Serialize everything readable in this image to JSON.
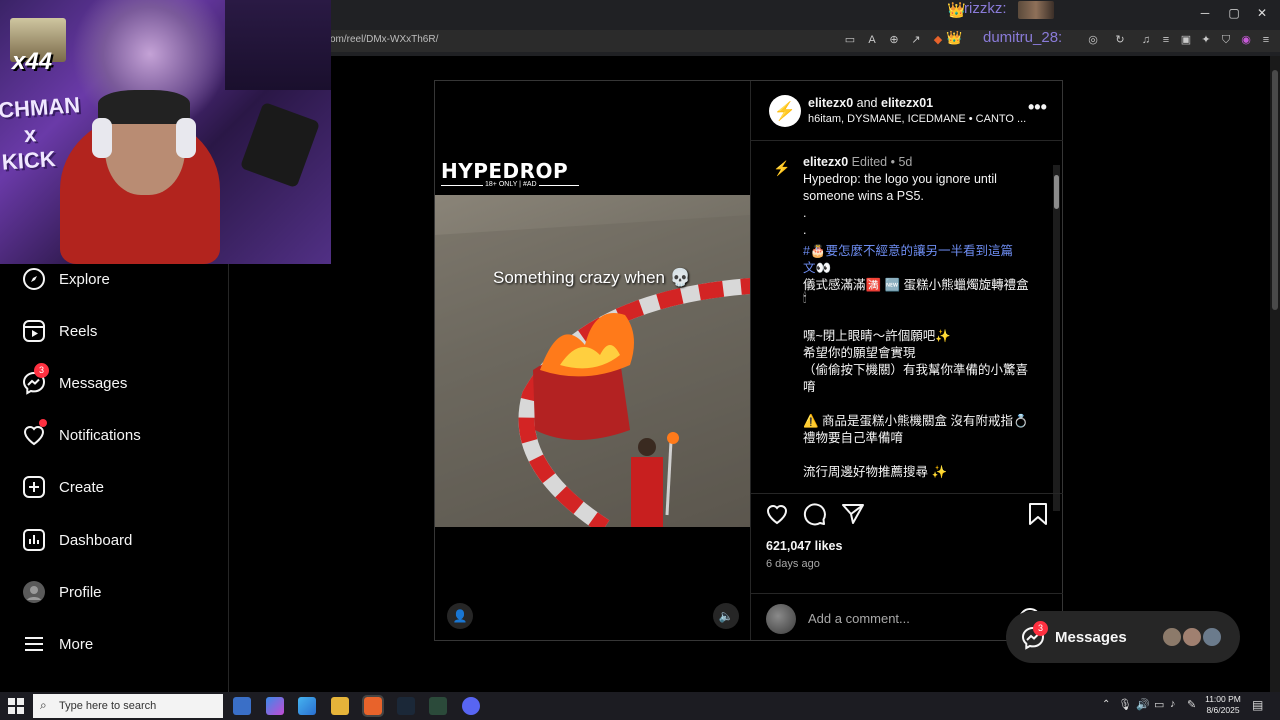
{
  "browser": {
    "url": "om/reel/DMx-WXxTh6R/",
    "chat_overlay": [
      {
        "user": "rizzkz:"
      },
      {
        "user": "dumitru_28:"
      },
      {
        "user": "dumitru_28:"
      }
    ]
  },
  "webcam": {
    "overlay_badge": "x44",
    "banner_line1": "CHMAN",
    "banner_line2": "x",
    "banner_line3": "KICK"
  },
  "sidebar": {
    "items": [
      {
        "label": "Explore",
        "icon": "compass-icon"
      },
      {
        "label": "Reels",
        "icon": "reels-icon"
      },
      {
        "label": "Messages",
        "icon": "messenger-icon",
        "badge": "3"
      },
      {
        "label": "Notifications",
        "icon": "heart-icon"
      },
      {
        "label": "Create",
        "icon": "plus-square-icon"
      },
      {
        "label": "Dashboard",
        "icon": "dashboard-icon"
      },
      {
        "label": "Profile",
        "icon": "avatar-icon"
      },
      {
        "label": "More",
        "icon": "hamburger-icon"
      }
    ]
  },
  "post": {
    "video": {
      "brand": "HYPEDROP",
      "brand_sub": "18+ ONLY | #AD",
      "overlay_text": "Something crazy when 💀"
    },
    "header": {
      "authors_a": "elitezx0",
      "authors_and": "and",
      "authors_b": "elitezx01",
      "audio": "h6itam, DYSMANE, ICEDMANE • CANTO ..."
    },
    "caption": {
      "user": "elitezx0",
      "edited": "Edited",
      "age": "5d",
      "lines": [
        "Hypedrop: the logo you ignore until",
        "someone wins a PS5.",
        ".",
        ".",
        "#🎂要怎麼不經意的讓另一半看到這篇",
        "文👀",
        "儀式感滿滿🈵 🆕 蛋糕小熊蠟燭旋轉禮盒",
        "🕯",
        "",
        "嘿~閉上眼睛～許個願吧✨",
        "希望你的願望會實現",
        "（偷偷按下機關）有我幫你準備的小驚喜",
        "唷",
        "",
        "⚠️ 商品是蛋糕小熊機關盒 沒有附戒指💍",
        "禮物要自己準備唷",
        "",
        "流行周邊好物推薦搜尋 ✨"
      ]
    },
    "likes": "621,047 likes",
    "posted": "6 days ago",
    "comment_placeholder": "Add a comment..."
  },
  "messages_pill": {
    "label": "Messages",
    "badge": "3"
  },
  "taskbar": {
    "search_placeholder": "Type here to search",
    "time": "11:00 PM",
    "date": "8/6/2025"
  },
  "colors": {
    "accent_link": "#6d8cf0",
    "badge_red": "#ff3040",
    "chat_purple": "#8a7bd8"
  }
}
